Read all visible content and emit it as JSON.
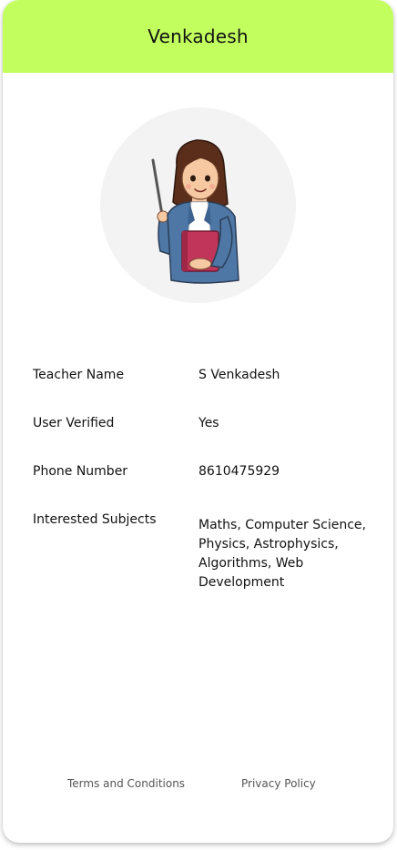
{
  "header": {
    "title": "Venkadesh"
  },
  "avatar": {
    "icon": "teacher-illustration-icon",
    "background_color": "#f3f3f3"
  },
  "details": [
    {
      "label": "Teacher Name",
      "value": "S Venkadesh"
    },
    {
      "label": "User Verified",
      "value": "Yes"
    },
    {
      "label": "Phone Number",
      "value": "8610475929"
    },
    {
      "label": "Interested Subjects",
      "value": "Maths, Computer Science, Physics, Astrophysics, Algorithms, Web Development"
    }
  ],
  "footer": {
    "terms_label": "Terms and Conditions",
    "privacy_label": "Privacy Policy"
  },
  "colors": {
    "header_background": "#c2fe5e",
    "card_background": "#ffffff"
  }
}
